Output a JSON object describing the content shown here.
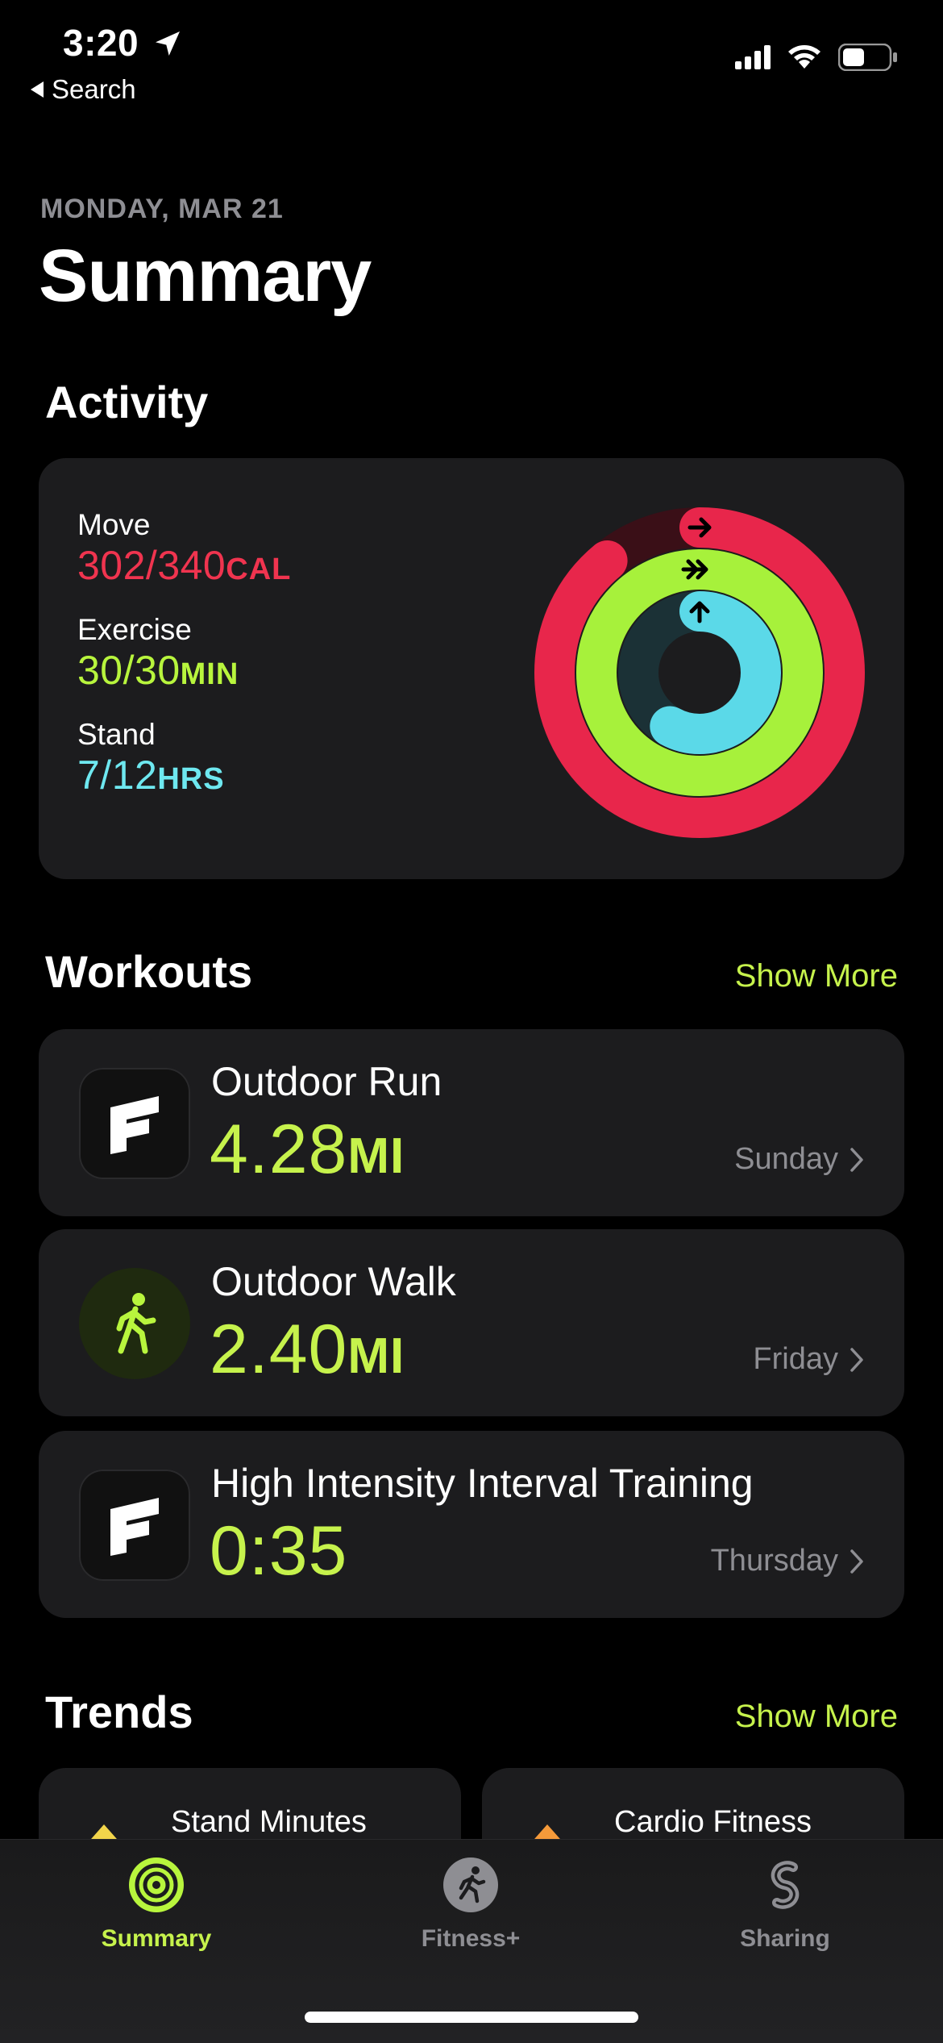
{
  "status": {
    "time": "3:20",
    "back_label": "Search"
  },
  "header": {
    "date": "MONDAY, MAR 21",
    "title": "Summary"
  },
  "activity": {
    "title": "Activity",
    "move": {
      "label": "Move",
      "value": "302/340",
      "unit": "CAL",
      "progress": 0.89
    },
    "exercise": {
      "label": "Exercise",
      "value": "30/30",
      "unit": "MIN",
      "progress": 1.0
    },
    "stand": {
      "label": "Stand",
      "value": "7/12",
      "unit": "HRS",
      "progress": 0.58
    }
  },
  "workouts": {
    "title": "Workouts",
    "show_more": "Show More",
    "items": [
      {
        "name": "Outdoor Run",
        "value": "4.28",
        "unit": "MI",
        "day": "Sunday",
        "icon": "fitbod-icon"
      },
      {
        "name": "Outdoor Walk",
        "value": "2.40",
        "unit": "MI",
        "day": "Friday",
        "icon": "walk-icon"
      },
      {
        "name": "High Intensity Interval Training",
        "value": "0:35",
        "unit": "",
        "day": "Thursday",
        "icon": "fitbod-icon"
      }
    ]
  },
  "trends": {
    "title": "Trends",
    "show_more": "Show More",
    "items": [
      {
        "label": "Stand Minutes"
      },
      {
        "label": "Cardio Fitness"
      }
    ]
  },
  "tabbar": {
    "summary": "Summary",
    "fitness": "Fitness+",
    "sharing": "Sharing"
  },
  "colors": {
    "move": "#e8264b",
    "exercise": "#a7f13b",
    "stand": "#5bd9e8",
    "accent": "#c6f24c",
    "card": "#1c1c1e"
  }
}
